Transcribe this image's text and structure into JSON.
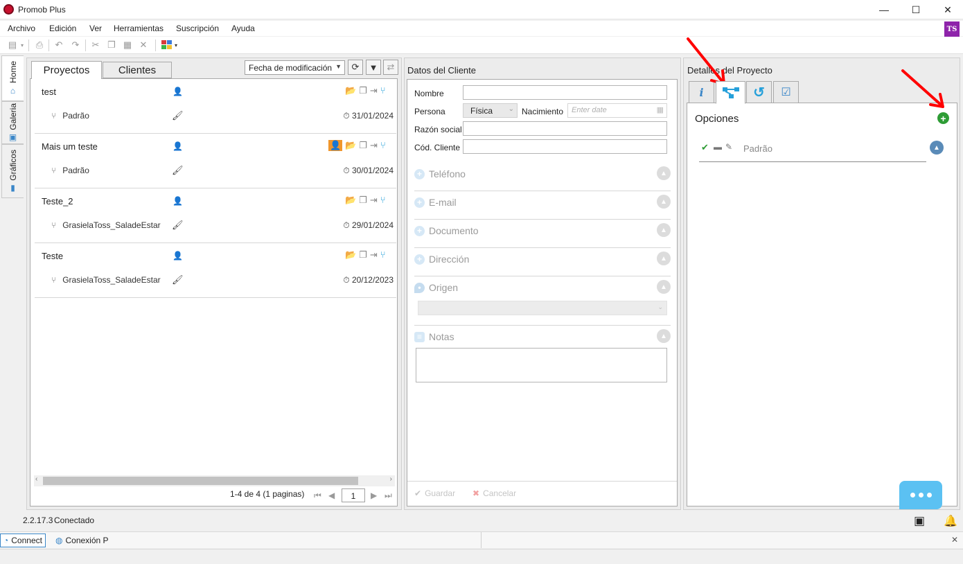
{
  "window": {
    "title": "Promob Plus",
    "minimize": "—",
    "maximize": "☐",
    "close": "✕"
  },
  "menu": {
    "items": [
      "Archivo",
      "Edición",
      "Ver",
      "Herramientas",
      "Suscripción",
      "Ayuda"
    ],
    "user_initials": "TS"
  },
  "toolbar": {
    "icons": [
      "save-icon",
      "print-icon",
      "undo-icon",
      "redo-icon",
      "cut-icon",
      "copy-icon",
      "paste-icon",
      "delete-icon",
      "color-palette-icon"
    ]
  },
  "sidebar": {
    "tabs": [
      "Home",
      "Galeria",
      "Gráficos"
    ]
  },
  "projects": {
    "tabs": [
      "Proyectos",
      "Clientes"
    ],
    "sort_label": "Fecha de modificación",
    "items": [
      {
        "name": "test",
        "sub": "Padrão",
        "date": "31/01/2024"
      },
      {
        "name": "Mais um teste",
        "sub": "Padrão",
        "date": "30/01/2024"
      },
      {
        "name": "Teste_2",
        "sub": "GrasielaToss_SaladeEstar",
        "date": "29/01/2024"
      },
      {
        "name": "Teste",
        "sub": "GrasielaToss_SaladeEstar",
        "date": "20/12/2023"
      }
    ],
    "pager_text": "1-4 de 4 (1 paginas)",
    "page_value": "1"
  },
  "client": {
    "title": "Datos del Cliente",
    "labels": {
      "nombre": "Nombre",
      "persona": "Persona",
      "nacimiento": "Nacimiento",
      "razon": "Razón social",
      "cod": "Cód. Cliente"
    },
    "persona_value": "Física",
    "date_placeholder": "Enter date",
    "sections": [
      "Teléfono",
      "E-mail",
      "Documento",
      "Dirección",
      "Origen",
      "Notas"
    ],
    "save_label": "Guardar",
    "cancel_label": "Cancelar"
  },
  "details": {
    "title": "Detalles del Proyecto",
    "options_title": "Opciones",
    "option_name": "Padrão"
  },
  "status": {
    "version": "2.2.17.3",
    "state": "Conectado"
  },
  "bottom_tabs": [
    "Connect",
    "Conexión P"
  ],
  "colors": {
    "accent": "#3a86c8",
    "annotation_arrow": "#ff0000",
    "add_green": "#2e9c35",
    "chat": "#5bc1f2"
  }
}
